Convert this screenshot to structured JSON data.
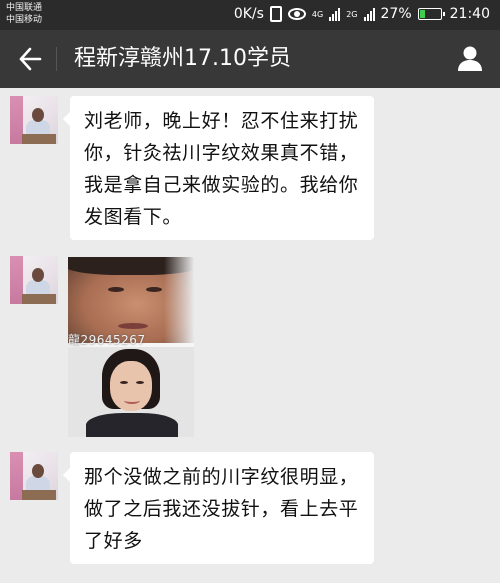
{
  "status_bar": {
    "carrier_1": "中国联通",
    "carrier_2": "中国移动",
    "speed": "0K/s",
    "net_1": "4G",
    "net_2": "2G",
    "battery": "27%",
    "battery_level": 0.27,
    "time": "21:40"
  },
  "nav": {
    "title": "程新淳赣州17.10学员"
  },
  "messages": [
    {
      "type": "text",
      "text": "刘老师，晚上好！忍不住来打扰你，针灸祛川字纹效果真不错，我是拿自己来做实验的。我给你发图看下。"
    },
    {
      "type": "image",
      "watermark": "龍29645267"
    },
    {
      "type": "text",
      "text": "那个没做之前的川字纹很明显，做了之后我还没拔针，看上去平了好多"
    }
  ],
  "colors": {
    "status_bar": "#2b2b2b",
    "nav_bar": "#383838",
    "chat_background": "#ebebeb",
    "bubble": "#ffffff",
    "battery_fill": "#3dcf4d"
  }
}
